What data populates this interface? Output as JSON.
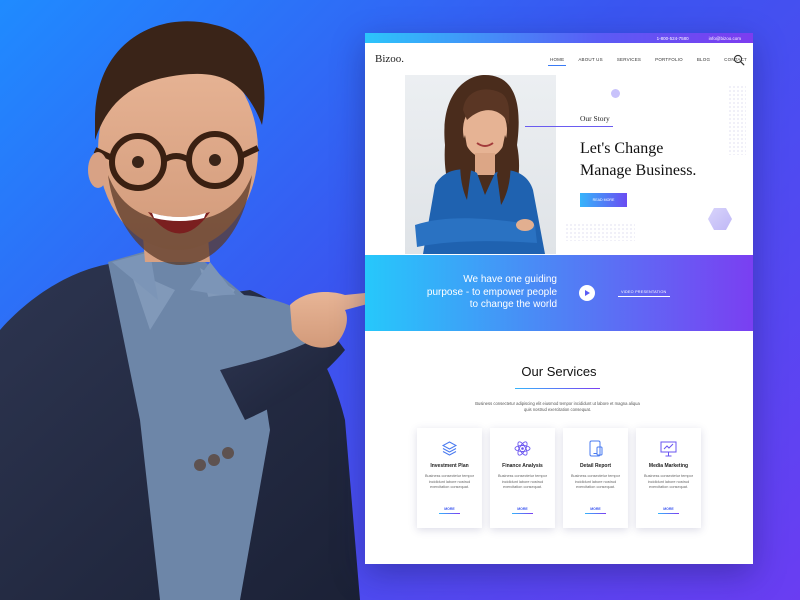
{
  "colors": {
    "background_start": "#1f8bff",
    "background_end": "#6a3df2",
    "accent_cyan": "#26c8fb",
    "accent_purple": "#7a3ff2",
    "text_dark": "#111111"
  },
  "topbar": {
    "phone": "1-800-524-7580",
    "email": "info@bizoo.com"
  },
  "nav": {
    "logo": "Bizoo.",
    "items": [
      {
        "label": "HOME",
        "active": true
      },
      {
        "label": "ABOUT US",
        "active": false
      },
      {
        "label": "SERVICES",
        "active": false
      },
      {
        "label": "PORTFOLIO",
        "active": false
      },
      {
        "label": "BLOG",
        "active": false
      },
      {
        "label": "CONTACT",
        "active": false
      }
    ],
    "search_icon": "search-icon"
  },
  "hero": {
    "kicker": "Our Story",
    "title_line1": "Let's Change",
    "title_line2": "Manage Business.",
    "button": "READ MORE"
  },
  "band": {
    "line1": "We have one guiding",
    "line2": "purpose - to empower people",
    "line3": "to change the world",
    "video_label": "VIDEO PRESENTATION",
    "play_icon": "play-icon"
  },
  "services": {
    "title": "Our Services",
    "description": "Business consectetur adipiscing elit eiusmod tempor incididunt ut labore et magna aliqua quis nostrud exercitation consequat.",
    "cards": [
      {
        "icon": "layers-icon",
        "title": "Investment Plan",
        "text": "Business consectetur tempor incididunt labore nostrud exercitation consequat.",
        "more": "MORE"
      },
      {
        "icon": "atom-icon",
        "title": "Finance Analysis",
        "text": "Business consectetur tempor incididunt labore nostrud exercitation consequat.",
        "more": "MORE"
      },
      {
        "icon": "devices-icon",
        "title": "Detail Report",
        "text": "Business consectetur tempor incididunt labore nostrud exercitation consequat.",
        "more": "MORE"
      },
      {
        "icon": "presentation-icon",
        "title": "Media Marketing",
        "text": "Business consectetur tempor incididunt labore nostrud exercitation consequat.",
        "more": "MORE"
      }
    ]
  }
}
